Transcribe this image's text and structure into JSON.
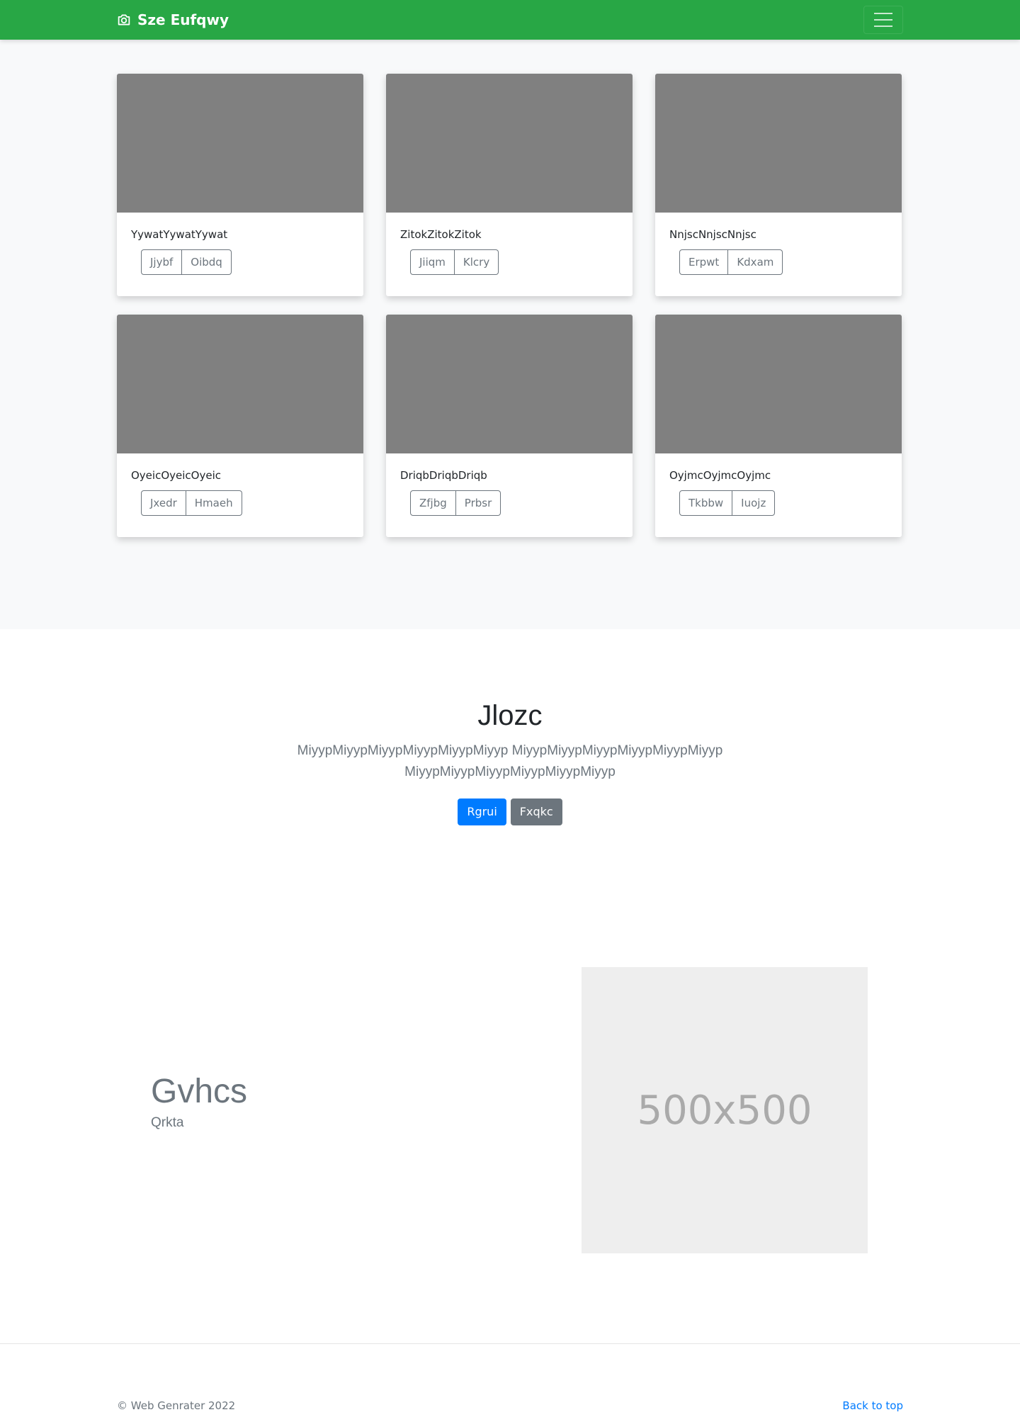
{
  "navbar": {
    "brand": "Sze Eufqwy",
    "brand_icon": "camera-icon",
    "accent": "#28a745"
  },
  "cards": [
    {
      "text": "YywatYywatYywat",
      "buttons": [
        "Jjybf",
        "Oibdq"
      ]
    },
    {
      "text": "ZitokZitokZitok",
      "buttons": [
        "Jiiqm",
        "Klcry"
      ]
    },
    {
      "text": "NnjscNnjscNnjsc",
      "buttons": [
        "Erpwt",
        "Kdxam"
      ]
    },
    {
      "text": "OyeicOyeicOyeic",
      "buttons": [
        "Jxedr",
        "Hmaeh"
      ]
    },
    {
      "text": "DriqbDriqbDriqb",
      "buttons": [
        "Zfjbg",
        "Prbsr"
      ]
    },
    {
      "text": "OyjmcOyjmcOyjmc",
      "buttons": [
        "Tkbbw",
        "Iuojz"
      ]
    }
  ],
  "jumbotron": {
    "title": "Jlozc",
    "lead": "MiyypMiyypMiyypMiyypMiyypMiyyp MiyypMiyypMiyypMiyypMiyypMiyyp MiyypMiyypMiyypMiyypMiyypMiyyp",
    "primary_button": "Rgrui",
    "secondary_button": "Fxqkc"
  },
  "feature": {
    "heading": "Gvhcs",
    "subheading": "Qrkta",
    "placeholder": "500x500"
  },
  "footer": {
    "copyright": "© Web Genrater 2022",
    "back_to_top": "Back to top"
  }
}
